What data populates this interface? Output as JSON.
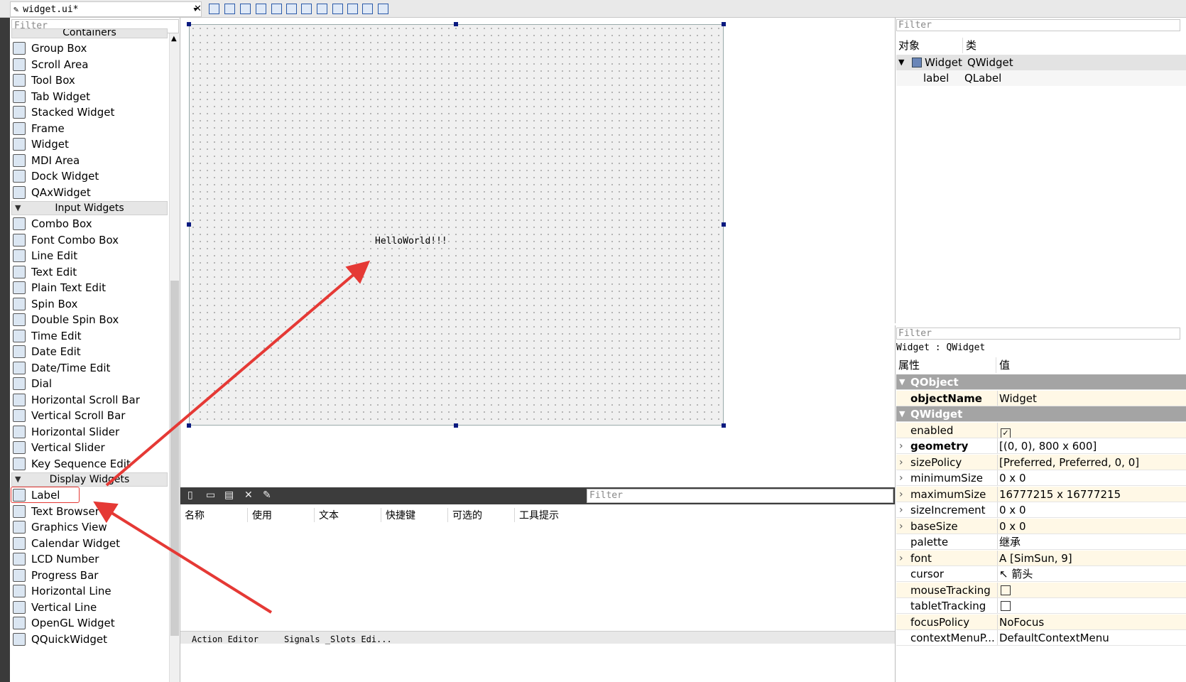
{
  "document": {
    "tab_title": "widget.ui*",
    "dropdown_glyph": "▾",
    "close_glyph": "✕"
  },
  "widget_box": {
    "filter_placeholder": "Filter",
    "categories": {
      "containers": "Containers",
      "input_widgets": "Input Widgets",
      "display_widgets": "Display Widgets"
    },
    "container_items": [
      "Group Box",
      "Scroll Area",
      "Tool Box",
      "Tab Widget",
      "Stacked Widget",
      "Frame",
      "Widget",
      "MDI Area",
      "Dock Widget",
      "QAxWidget"
    ],
    "input_items": [
      "Combo Box",
      "Font Combo Box",
      "Line Edit",
      "Text Edit",
      "Plain Text Edit",
      "Spin Box",
      "Double Spin Box",
      "Time Edit",
      "Date Edit",
      "Date/Time Edit",
      "Dial",
      "Horizontal Scroll Bar",
      "Vertical Scroll Bar",
      "Horizontal Slider",
      "Vertical Slider",
      "Key Sequence Edit"
    ],
    "display_items": [
      "Label",
      "Text Browser",
      "Graphics View",
      "Calendar Widget",
      "LCD Number",
      "Progress Bar",
      "Horizontal Line",
      "Vertical Line",
      "OpenGL Widget",
      "QQuickWidget"
    ]
  },
  "form": {
    "label_text": "HelloWorld!!!"
  },
  "action_editor": {
    "filter_placeholder": "Filter",
    "columns": [
      "名称",
      "使用",
      "文本",
      "快捷键",
      "可选的",
      "工具提示"
    ],
    "tabs": [
      "Action Editor",
      "Signals _Slots Edi..."
    ]
  },
  "object_inspector": {
    "filter_placeholder": "Filter",
    "headers": {
      "object": "对象",
      "class": "类"
    },
    "rows": [
      {
        "object": "Widget",
        "class": "QWidget"
      },
      {
        "object": "label",
        "class": "QLabel"
      }
    ]
  },
  "property_editor": {
    "filter_placeholder": "Filter",
    "class_line": "Widget : QWidget",
    "headers": {
      "property": "属性",
      "value": "值"
    },
    "groups": [
      {
        "name": "QObject",
        "props": [
          {
            "name": "objectName",
            "value": "Widget",
            "bold": true
          }
        ]
      },
      {
        "name": "QWidget",
        "props": [
          {
            "name": "enabled",
            "value": "✓",
            "checkbox": true
          },
          {
            "name": "geometry",
            "value": "[(0, 0), 800 x 600]",
            "bold": true,
            "expand": true
          },
          {
            "name": "sizePolicy",
            "value": "[Preferred, Preferred, 0, 0]",
            "expand": true
          },
          {
            "name": "minimumSize",
            "value": "0 x 0",
            "expand": true
          },
          {
            "name": "maximumSize",
            "value": "16777215 x 16777215",
            "expand": true
          },
          {
            "name": "sizeIncrement",
            "value": "0 x 0",
            "expand": true
          },
          {
            "name": "baseSize",
            "value": "0 x 0",
            "expand": true
          },
          {
            "name": "palette",
            "value": "继承"
          },
          {
            "name": "font",
            "value": "A  [SimSun, 9]",
            "expand": true
          },
          {
            "name": "cursor",
            "value": "↖  箭头"
          },
          {
            "name": "mouseTracking",
            "value": "",
            "checkbox": true
          },
          {
            "name": "tabletTracking",
            "value": "",
            "checkbox": true
          },
          {
            "name": "focusPolicy",
            "value": "NoFocus"
          },
          {
            "name": "contextMenuP...",
            "value": "DefaultContextMenu"
          }
        ]
      }
    ]
  },
  "annotation": {
    "color": "#e53935"
  }
}
